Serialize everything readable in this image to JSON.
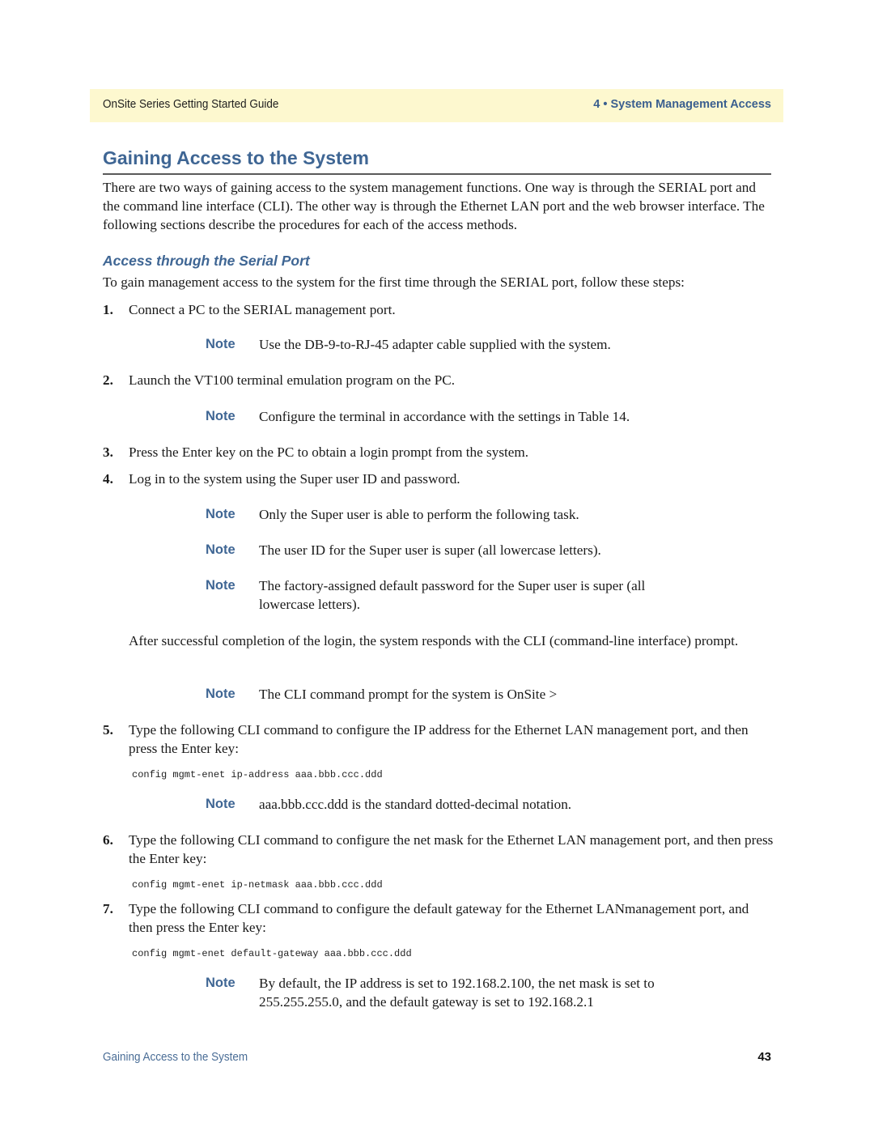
{
  "header": {
    "left": "OnSite Series Getting Started Guide",
    "right": "4 • System Management Access"
  },
  "page_title": "Gaining Access to the System",
  "intro": "There are two ways of gaining access to the system management functions. One way is through the SERIAL port and the command line interface (CLI). The other way is through the Ethernet LAN port and the web browser interface. The following sections describe the procedures for each of the access methods.",
  "section": {
    "heading": "Access through the Serial Port",
    "lead": "To gain management access to the system for the first time through the SERIAL port, follow these steps:"
  },
  "note_label": "Note",
  "steps": [
    {
      "num": "1.",
      "text": "Connect a PC to the SERIAL management port."
    },
    {
      "num": "2.",
      "text": "Launch the VT100 terminal emulation program on the PC."
    },
    {
      "num": "3.",
      "text": "Press the Enter key on the PC to obtain a login prompt from the system."
    },
    {
      "num": "4.",
      "text": "Log in to the system using the Super user ID and password."
    },
    {
      "num": "5.",
      "text": "Type the following CLI command to configure the IP address for the Ethernet LAN management port, and then press the Enter key:"
    },
    {
      "num": "6.",
      "text": "Type the following CLI command to configure the net mask for the Ethernet LAN management port, and then press the Enter key:"
    },
    {
      "num": "7.",
      "text": "Type the following CLI command to configure the default gateway for the Ethernet LANmanagement port, and then press the Enter key:"
    }
  ],
  "notes": [
    "Use the DB-9-to-RJ-45 adapter cable supplied with the system.",
    "Configure the terminal in accordance with the settings in Table 14.",
    "Only the Super user is able to perform the following task.",
    "The user ID for the Super user is super (all lowercase letters).",
    "The factory-assigned default password for the Super user is super (all lowercase letters).",
    "The CLI command prompt for the system is OnSite >",
    "aaa.bbb.ccc.ddd is the standard dotted-decimal notation.",
    "By default, the IP address is set to 192.168.2.100, the net mask is set to 255.255.255.0, and the default gateway is set to 192.168.2.1"
  ],
  "after_login": "After successful completion of the login, the system responds with the CLI (command-line interface) prompt.",
  "commands": [
    "config mgmt-enet ip-address aaa.bbb.ccc.ddd",
    "config mgmt-enet ip-netmask aaa.bbb.ccc.ddd",
    "config mgmt-enet default-gateway aaa.bbb.ccc.ddd"
  ],
  "footer": {
    "left": "Gaining Access to the System",
    "page_number": "43"
  }
}
